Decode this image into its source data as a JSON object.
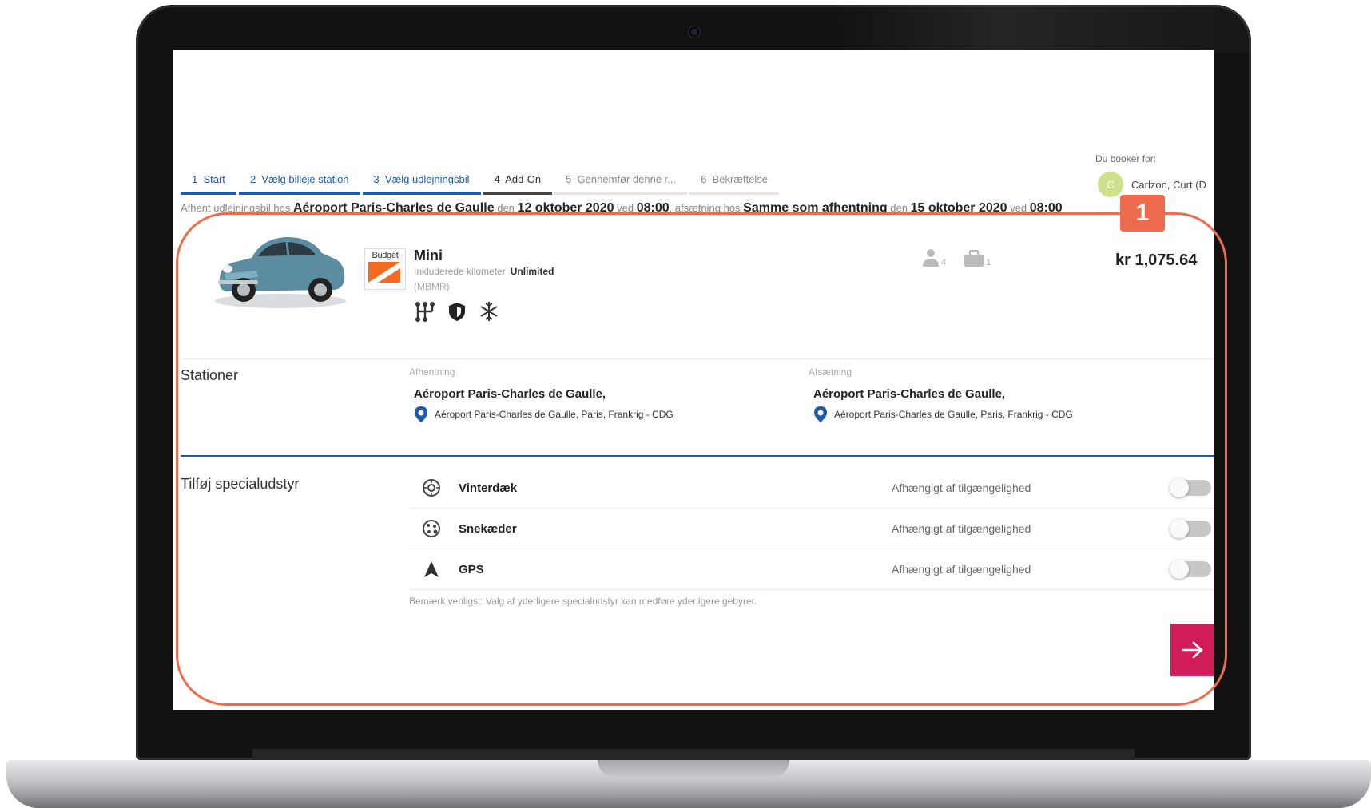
{
  "booker": {
    "label": "Du booker for:",
    "initial": "C",
    "name": "Carlzon, Curt (D"
  },
  "steps": [
    {
      "num": "1",
      "label": "Start",
      "state": "done"
    },
    {
      "num": "2",
      "label": "Vælg billeje station",
      "state": "done"
    },
    {
      "num": "3",
      "label": "Vælg udlejningsbil",
      "state": "done"
    },
    {
      "num": "4",
      "label": "Add-On",
      "state": "current"
    },
    {
      "num": "5",
      "label": "Gennemfør denne r...",
      "state": "future"
    },
    {
      "num": "6",
      "label": "Bekræftelse",
      "state": "future"
    }
  ],
  "summary": {
    "pickup_prefix": "Afhent udlejningsbil hos",
    "pickup_location": "Aéroport Paris-Charles de Gaulle",
    "date_prefix": "den",
    "pickup_date": "12 oktober 2020",
    "time_prefix": "ved",
    "pickup_time": "08:00",
    "dropoff_prefix": "afsætning hos",
    "dropoff_location": "Samme som afhentning",
    "dropoff_date": "15 oktober 2020",
    "dropoff_time": "08:00"
  },
  "car": {
    "brand": "Budget",
    "name": "Mini",
    "km_label": "Inkluderede kilometer",
    "km_value": "Unlimited",
    "code": "(MBMR)",
    "features": [
      "manual-gearbox-icon",
      "insurance-shield-icon",
      "air-conditioning-icon"
    ],
    "passengers": "4",
    "bags": "1",
    "price": "kr 1,075.64"
  },
  "stations": {
    "title": "Stationer",
    "pickup": {
      "label": "Afhentning",
      "name": "Aéroport Paris-Charles de Gaulle,",
      "address": "Aéroport Paris-Charles de Gaulle, Paris, Frankrig - CDG"
    },
    "dropoff": {
      "label": "Afsætning",
      "name": "Aéroport Paris-Charles de Gaulle,",
      "address": "Aéroport Paris-Charles de Gaulle, Paris, Frankrig - CDG"
    }
  },
  "addons": {
    "title": "Tilføj specialudstyr",
    "items": [
      {
        "name": "Vinterdæk",
        "availability": "Afhængigt af tilgængelighed",
        "icon": "winter-tire-icon",
        "enabled": false
      },
      {
        "name": "Snekæder",
        "availability": "Afhængigt af tilgængelighed",
        "icon": "snow-chain-icon",
        "enabled": false
      },
      {
        "name": "GPS",
        "availability": "Afhængigt af tilgængelighed",
        "icon": "gps-arrow-icon",
        "enabled": false
      }
    ],
    "note": "Bemærk venligst: Valg af yderligere specialudstyr kan medføre yderligere gebyrer."
  },
  "annotation": {
    "badge": "1",
    "color": "#ee6b4d"
  },
  "colors": {
    "accent_blue": "#1f5aa6",
    "next_button": "#d01c5a",
    "brand_orange": "#f26b21"
  }
}
